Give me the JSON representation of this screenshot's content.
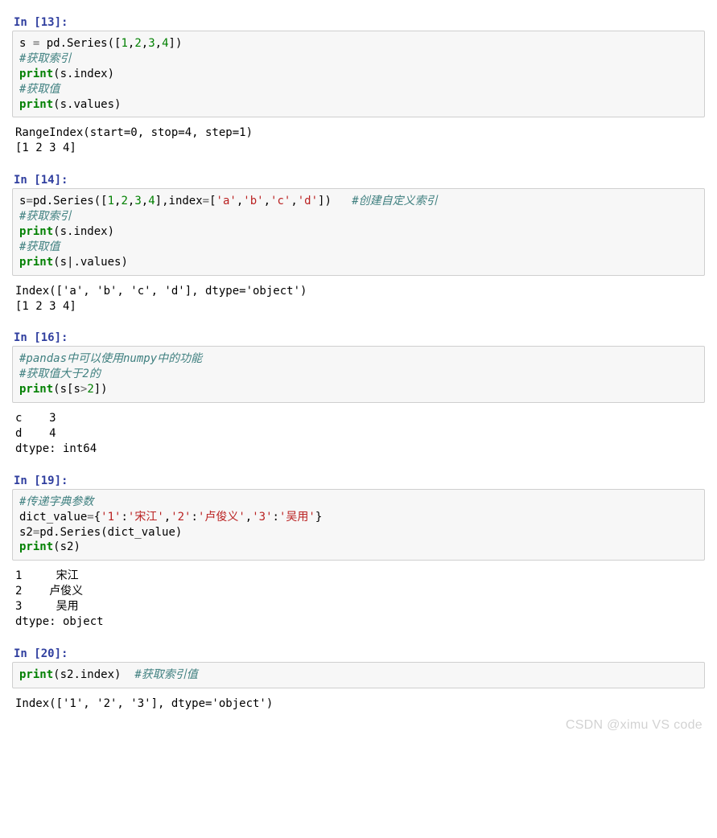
{
  "watermark": "CSDN @ximu VS code",
  "cells": [
    {
      "prompt": "In [13]:",
      "code_tokens": [
        {
          "t": "s ",
          "c": "c-id"
        },
        {
          "t": "=",
          "c": "c-op"
        },
        {
          "t": " pd.Series([",
          "c": "c-id"
        },
        {
          "t": "1",
          "c": "c-num"
        },
        {
          "t": ",",
          "c": "c-id"
        },
        {
          "t": "2",
          "c": "c-num"
        },
        {
          "t": ",",
          "c": "c-id"
        },
        {
          "t": "3",
          "c": "c-num"
        },
        {
          "t": ",",
          "c": "c-id"
        },
        {
          "t": "4",
          "c": "c-num"
        },
        {
          "t": "])",
          "c": "c-id"
        },
        {
          "t": "\n",
          "c": ""
        },
        {
          "t": "#获取索引",
          "c": "c-cmt"
        },
        {
          "t": "\n",
          "c": ""
        },
        {
          "t": "print",
          "c": "c-kw"
        },
        {
          "t": "(s.index)",
          "c": "c-id"
        },
        {
          "t": "\n",
          "c": ""
        },
        {
          "t": "#获取值",
          "c": "c-cmt"
        },
        {
          "t": "\n",
          "c": ""
        },
        {
          "t": "print",
          "c": "c-kw"
        },
        {
          "t": "(s.values)",
          "c": "c-id"
        }
      ],
      "output": "RangeIndex(start=0, stop=4, step=1)\n[1 2 3 4]"
    },
    {
      "prompt": "In [14]:",
      "code_tokens": [
        {
          "t": "s",
          "c": "c-id"
        },
        {
          "t": "=",
          "c": "c-op"
        },
        {
          "t": "pd.Series([",
          "c": "c-id"
        },
        {
          "t": "1",
          "c": "c-num"
        },
        {
          "t": ",",
          "c": "c-id"
        },
        {
          "t": "2",
          "c": "c-num"
        },
        {
          "t": ",",
          "c": "c-id"
        },
        {
          "t": "3",
          "c": "c-num"
        },
        {
          "t": ",",
          "c": "c-id"
        },
        {
          "t": "4",
          "c": "c-num"
        },
        {
          "t": "],index",
          "c": "c-id"
        },
        {
          "t": "=",
          "c": "c-op"
        },
        {
          "t": "[",
          "c": "c-id"
        },
        {
          "t": "'a'",
          "c": "c-str"
        },
        {
          "t": ",",
          "c": "c-id"
        },
        {
          "t": "'b'",
          "c": "c-str"
        },
        {
          "t": ",",
          "c": "c-id"
        },
        {
          "t": "'c'",
          "c": "c-str"
        },
        {
          "t": ",",
          "c": "c-id"
        },
        {
          "t": "'d'",
          "c": "c-str"
        },
        {
          "t": "])   ",
          "c": "c-id"
        },
        {
          "t": "#创建自定义索引",
          "c": "c-cmt"
        },
        {
          "t": "\n",
          "c": ""
        },
        {
          "t": "#获取索引",
          "c": "c-cmt"
        },
        {
          "t": "\n",
          "c": ""
        },
        {
          "t": "print",
          "c": "c-kw"
        },
        {
          "t": "(s.index)",
          "c": "c-id"
        },
        {
          "t": "\n",
          "c": ""
        },
        {
          "t": "#获取值",
          "c": "c-cmt"
        },
        {
          "t": "\n",
          "c": ""
        },
        {
          "t": "print",
          "c": "c-kw"
        },
        {
          "t": "(s|.values)",
          "c": "c-id"
        }
      ],
      "output": "Index(['a', 'b', 'c', 'd'], dtype='object')\n[1 2 3 4]"
    },
    {
      "prompt": "In [16]:",
      "code_tokens": [
        {
          "t": "#pandas中可以使用numpy中的功能",
          "c": "c-cmt"
        },
        {
          "t": "\n",
          "c": ""
        },
        {
          "t": "#获取值大于2的",
          "c": "c-cmt"
        },
        {
          "t": "\n",
          "c": ""
        },
        {
          "t": "print",
          "c": "c-kw"
        },
        {
          "t": "(s[s",
          "c": "c-id"
        },
        {
          "t": ">",
          "c": "c-op"
        },
        {
          "t": "2",
          "c": "c-num"
        },
        {
          "t": "])",
          "c": "c-id"
        }
      ],
      "output": "c    3\nd    4\ndtype: int64"
    },
    {
      "prompt": "In [19]:",
      "code_tokens": [
        {
          "t": "#传递字典参数",
          "c": "c-cmt"
        },
        {
          "t": "\n",
          "c": ""
        },
        {
          "t": "dict_value",
          "c": "c-id"
        },
        {
          "t": "=",
          "c": "c-op"
        },
        {
          "t": "{",
          "c": "c-id"
        },
        {
          "t": "'1'",
          "c": "c-str"
        },
        {
          "t": ":",
          "c": "c-id"
        },
        {
          "t": "'宋江'",
          "c": "c-str"
        },
        {
          "t": ",",
          "c": "c-id"
        },
        {
          "t": "'2'",
          "c": "c-str"
        },
        {
          "t": ":",
          "c": "c-id"
        },
        {
          "t": "'卢俊义'",
          "c": "c-str"
        },
        {
          "t": ",",
          "c": "c-id"
        },
        {
          "t": "'3'",
          "c": "c-str"
        },
        {
          "t": ":",
          "c": "c-id"
        },
        {
          "t": "'吴用'",
          "c": "c-str"
        },
        {
          "t": "}",
          "c": "c-id"
        },
        {
          "t": "\n",
          "c": ""
        },
        {
          "t": "s2",
          "c": "c-id"
        },
        {
          "t": "=",
          "c": "c-op"
        },
        {
          "t": "pd.Series(dict_value)",
          "c": "c-id"
        },
        {
          "t": "\n",
          "c": ""
        },
        {
          "t": "print",
          "c": "c-kw"
        },
        {
          "t": "(s2)",
          "c": "c-id"
        }
      ],
      "output": "1     宋江\n2    卢俊义\n3     吴用\ndtype: object"
    },
    {
      "prompt": "In [20]:",
      "code_tokens": [
        {
          "t": "print",
          "c": "c-kw"
        },
        {
          "t": "(s2.index)  ",
          "c": "c-id"
        },
        {
          "t": "#获取索引值",
          "c": "c-cmt"
        }
      ],
      "output": "Index(['1', '2', '3'], dtype='object')"
    }
  ]
}
